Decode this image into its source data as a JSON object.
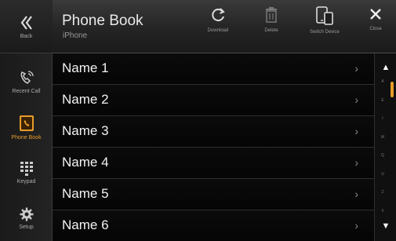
{
  "header": {
    "title": "Phone Book",
    "subtitle": "iPhone",
    "actions": [
      {
        "label": "Download",
        "icon": "refresh-icon"
      },
      {
        "label": "Delete",
        "icon": "trash-icon"
      },
      {
        "label": "Switch Device",
        "icon": "devices-icon"
      },
      {
        "label": "Close",
        "icon": "close-icon"
      }
    ]
  },
  "nav": {
    "back_label": "Back",
    "items": [
      {
        "label": "Recent Call",
        "icon": "recent-call-icon",
        "active": false
      },
      {
        "label": "Phone Book",
        "icon": "phone-book-icon",
        "active": true
      },
      {
        "label": "Keypad",
        "icon": "keypad-icon",
        "active": false
      },
      {
        "label": "Setup",
        "icon": "gear-icon",
        "active": false
      }
    ]
  },
  "contacts": [
    {
      "name": "Name 1"
    },
    {
      "name": "Name 2"
    },
    {
      "name": "Name 3"
    },
    {
      "name": "Name 4"
    },
    {
      "name": "Name 5"
    },
    {
      "name": "Name 6"
    }
  ],
  "scroll_index": [
    "A",
    "E",
    "I",
    "M",
    "Q",
    "U",
    "Z",
    "#"
  ],
  "colors": {
    "accent": "#e89b2a",
    "background": "#000000",
    "header": "#2a2a2a"
  }
}
